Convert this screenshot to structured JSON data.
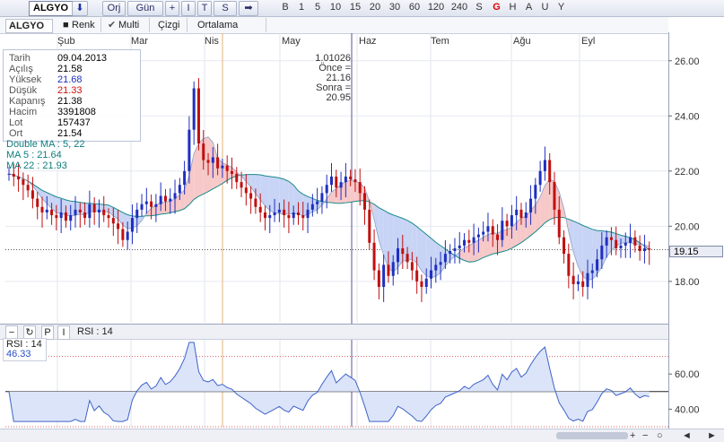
{
  "toolbar": {
    "symbol": "ALGYO",
    "orj": "Orj",
    "gun": "Gün",
    "plus": "+",
    "i": "I",
    "t": "T",
    "s": "S",
    "periods": [
      "B",
      "1",
      "5",
      "10",
      "15",
      "20",
      "30",
      "60",
      "120",
      "240",
      "S"
    ],
    "modes": [
      "G",
      "H",
      "A",
      "U",
      "Y"
    ]
  },
  "toolbar2": {
    "symbol": "ALGYO",
    "renk": "Renk",
    "multi": "Multi",
    "cizgi": "Çizgi",
    "ortalama": "Ortalama"
  },
  "info": {
    "rows": [
      {
        "label": "Tarih",
        "value": "09.04.2013"
      },
      {
        "label": "Açılış",
        "value": "21.58"
      },
      {
        "label": "Yüksek",
        "value": "21.68",
        "color": "#1f2fbf"
      },
      {
        "label": "Düşük",
        "value": "21.33",
        "color": "#d01010"
      },
      {
        "label": "Kapanış",
        "value": "21.38"
      },
      {
        "label": "Hacim",
        "value": "3391808"
      },
      {
        "label": "Lot",
        "value": "157437"
      },
      {
        "label": "Ort",
        "value": "21.54"
      }
    ],
    "ma_title": "Double MA : 5, 22",
    "ma5": "MA 5 : 21.64",
    "ma22": "MA 22 : 21.93"
  },
  "cursor_box": {
    "ratio": "1.01026",
    "before": "Önce = 21.16",
    "after": "Sonra = 20.95"
  },
  "rsi": {
    "title": "RSI : 14",
    "label": "RSI : 14",
    "value": "46.33"
  },
  "scrollbar": {
    "left_arrow": "◄",
    "right_arrow": "►"
  },
  "chart_data": [
    {
      "type": "candlestick",
      "months": [
        "Şub",
        "Mar",
        "Nis",
        "May",
        "Haz",
        "Tem",
        "Ağu",
        "Eyl"
      ],
      "y_ticks": [
        "26.00",
        "24.00",
        "22.00",
        "20.00",
        "18.00"
      ],
      "ylim": [
        16.5,
        27.0
      ],
      "last_price": "19.15",
      "up_color": "#1f2fbf",
      "down_color": "#c01010",
      "ma_fast_color": "#1a8a8a",
      "ma_slow_color": "#1a8a8a",
      "fill_up": "#f7c8c8",
      "fill_down": "#c8d4f5",
      "close": [
        21.9,
        21.8,
        21.7,
        21.5,
        21.3,
        21.0,
        20.7,
        20.5,
        20.6,
        20.4,
        20.3,
        20.5,
        20.2,
        20.4,
        20.6,
        20.5,
        20.3,
        20.8,
        20.5,
        20.6,
        20.4,
        20.3,
        20.1,
        19.9,
        19.5,
        19.8,
        20.3,
        20.6,
        20.8,
        20.9,
        20.7,
        20.8,
        21.1,
        20.9,
        21.0,
        21.2,
        21.5,
        22.0,
        23.5,
        25.0,
        23.0,
        22.4,
        22.3,
        22.5,
        22.1,
        22.2,
        22.0,
        21.9,
        21.6,
        21.4,
        21.2,
        21.0,
        20.7,
        20.5,
        20.3,
        20.4,
        20.5,
        20.6,
        20.4,
        20.3,
        20.5,
        20.4,
        20.3,
        20.6,
        20.8,
        20.9,
        21.2,
        21.5,
        21.8,
        21.4,
        21.6,
        21.8,
        21.7,
        21.6,
        21.2,
        20.6,
        19.4,
        18.4,
        17.8,
        18.6,
        18.2,
        18.7,
        19.2,
        19.0,
        18.7,
        18.4,
        18.0,
        17.8,
        18.1,
        18.4,
        18.6,
        18.7,
        19.0,
        19.1,
        19.2,
        19.3,
        19.5,
        19.4,
        19.6,
        19.7,
        19.8,
        20.0,
        19.7,
        19.5,
        20.2,
        20.0,
        20.4,
        20.6,
        20.3,
        20.5,
        21.0,
        21.5,
        22.0,
        22.4,
        21.6,
        20.6,
        19.6,
        19.0,
        18.2,
        17.9,
        18.0,
        17.8,
        18.3,
        18.4,
        18.8,
        19.3,
        19.6,
        19.5,
        19.2,
        19.3,
        19.4,
        19.6,
        19.3,
        19.1,
        19.2,
        19.15
      ],
      "rsi_ylim": [
        30,
        80
      ],
      "rsi_ticks": [
        "60.00",
        "40.00"
      ]
    }
  ]
}
